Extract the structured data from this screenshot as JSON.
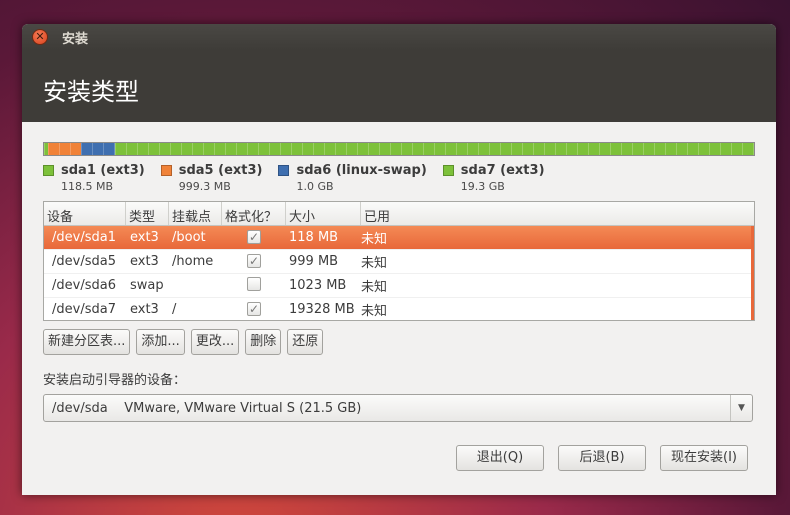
{
  "window": {
    "title": "安装",
    "heading": "安装类型"
  },
  "colors": {
    "ext3": "#7dc13a",
    "ext3_alt": "#f08238",
    "swap": "#3f6fb0",
    "selected_row": "#e8683a"
  },
  "partitions_bar": [
    {
      "name": "sda1",
      "color": "#7dc13a",
      "size_mb": 118.5
    },
    {
      "name": "sda5",
      "color": "#f08238",
      "size_mb": 999.3
    },
    {
      "name": "sda6",
      "color": "#3f6fb0",
      "size_mb": 1023
    },
    {
      "name": "sda7",
      "color": "#7dc13a",
      "size_mb": 19328
    }
  ],
  "legend": [
    {
      "label": "sda1 (ext3)",
      "size": "118.5 MB",
      "color": "#7dc13a"
    },
    {
      "label": "sda5 (ext3)",
      "size": "999.3 MB",
      "color": "#f08238"
    },
    {
      "label": "sda6 (linux-swap)",
      "size": "1.0 GB",
      "color": "#3f6fb0"
    },
    {
      "label": "sda7 (ext3)",
      "size": "19.3 GB",
      "color": "#7dc13a"
    }
  ],
  "table": {
    "headers": [
      "设备",
      "类型",
      "挂载点",
      "格式化？",
      "大小",
      "已用"
    ],
    "rows": [
      {
        "device": "/dev/sda1",
        "type": "ext3",
        "mount": "/boot",
        "format": true,
        "size": "118 MB",
        "used": "未知",
        "selected": true
      },
      {
        "device": "/dev/sda5",
        "type": "ext3",
        "mount": "/home",
        "format": true,
        "size": "999 MB",
        "used": "未知",
        "selected": false
      },
      {
        "device": "/dev/sda6",
        "type": "swap",
        "mount": "",
        "format": false,
        "size": "1023 MB",
        "used": "未知",
        "selected": false
      },
      {
        "device": "/dev/sda7",
        "type": "ext3",
        "mount": "/",
        "format": true,
        "size": "19328 MB",
        "used": "未知",
        "selected": false
      }
    ]
  },
  "buttons": {
    "new_table": "新建分区表...",
    "add": "添加...",
    "change": "更改...",
    "delete": "删除",
    "revert": "还原"
  },
  "boot_loader": {
    "label": "安装启动引导器的设备：",
    "selected": "/dev/sda    VMware, VMware Virtual S (21.5 GB)"
  },
  "actions": {
    "quit": "退出(Q)",
    "back": "后退(B)",
    "install": "现在安装(I)"
  }
}
